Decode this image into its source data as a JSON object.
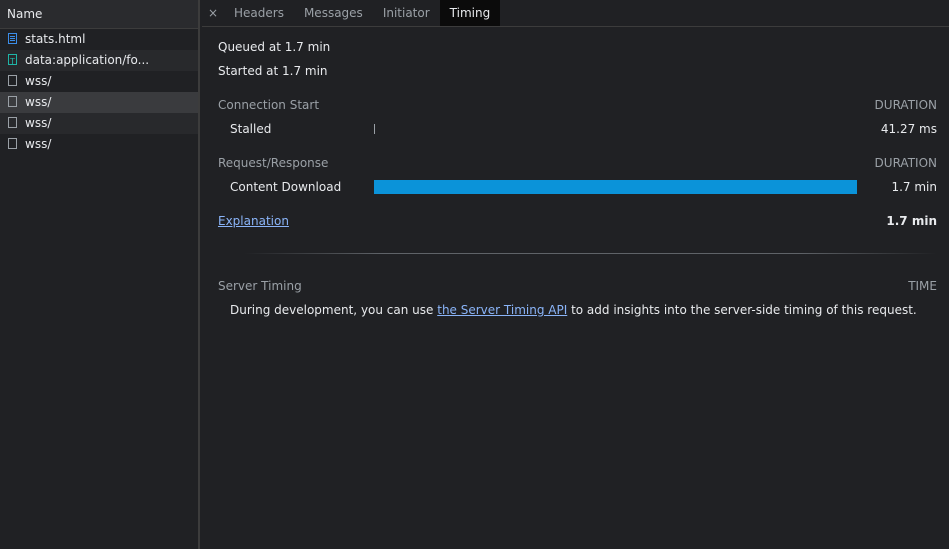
{
  "list": {
    "header": "Name",
    "rows": [
      {
        "name": "stats.html",
        "icon": "document-icon"
      },
      {
        "name": "data:application/fo...",
        "icon": "font-icon"
      },
      {
        "name": "wss/",
        "icon": "blank-icon"
      },
      {
        "name": "wss/",
        "icon": "blank-icon"
      },
      {
        "name": "wss/",
        "icon": "blank-icon"
      },
      {
        "name": "wss/",
        "icon": "blank-icon"
      }
    ]
  },
  "tabs": {
    "close": "×",
    "items": [
      "Headers",
      "Messages",
      "Initiator",
      "Timing"
    ],
    "active": "Timing"
  },
  "timing": {
    "queued": "Queued at 1.7 min",
    "started": "Started at 1.7 min",
    "connection_start": "Connection Start",
    "duration_label": "DURATION",
    "stalled_label": "Stalled",
    "stalled_value": "41.27 ms",
    "request_response": "Request/Response",
    "content_download_label": "Content Download",
    "content_download_value": "1.7 min",
    "explanation": "Explanation",
    "total": "1.7 min",
    "server_timing": "Server Timing",
    "time_label": "TIME",
    "server_text_before": "During development, you can use ",
    "server_link": "the Server Timing API",
    "server_text_after": " to add insights into the server-side timing of this request."
  },
  "colors": {
    "accent_bar": "#0b93d9",
    "link": "#8ab4f8"
  }
}
